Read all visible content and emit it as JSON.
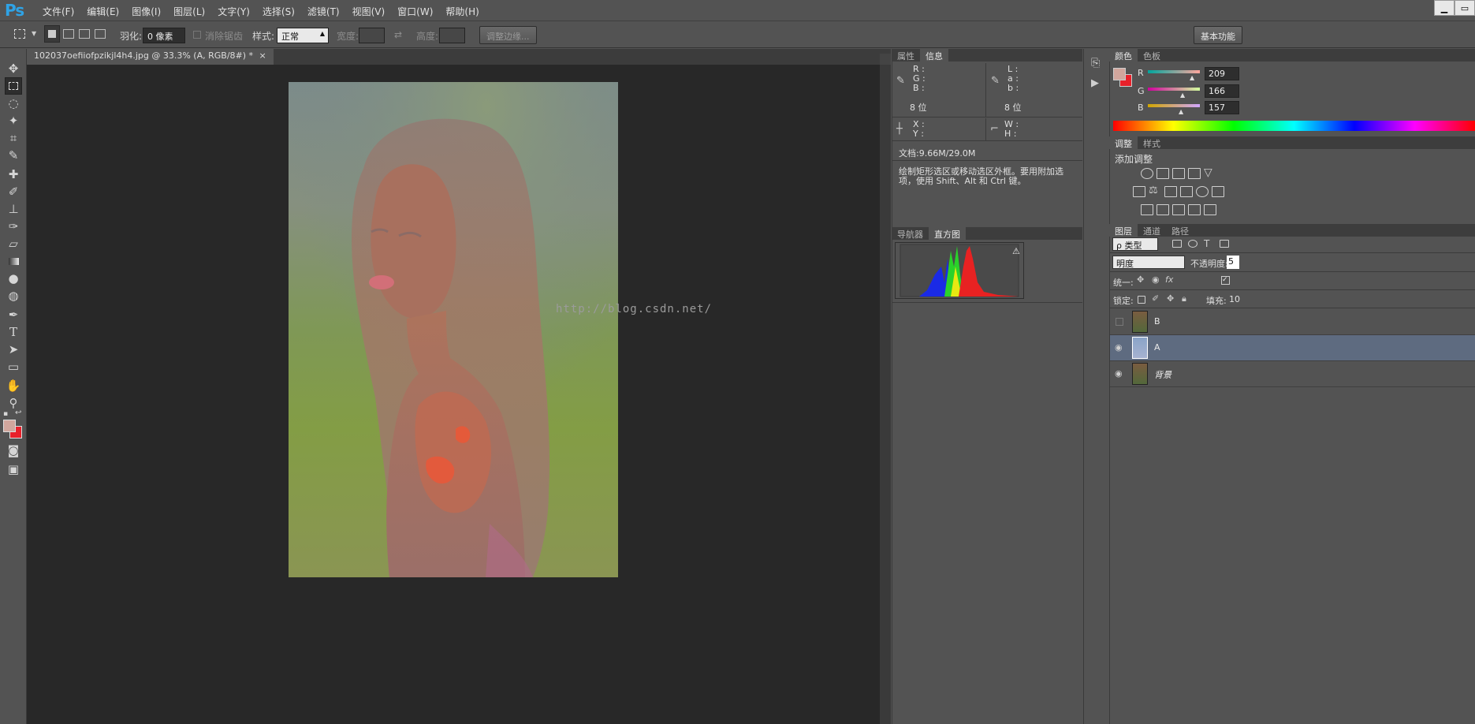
{
  "app": {
    "logo": "Ps"
  },
  "menu": [
    "文件(F)",
    "编辑(E)",
    "图像(I)",
    "图层(L)",
    "文字(Y)",
    "选择(S)",
    "滤镜(T)",
    "视图(V)",
    "窗口(W)",
    "帮助(H)"
  ],
  "window_controls": {
    "minimize": "▁",
    "restore": "▭"
  },
  "options": {
    "feather_label": "羽化:",
    "feather_value": "0 像素",
    "antialias_label": "消除锯齿",
    "style_label": "样式:",
    "style_value": "正常",
    "width_label": "宽度:",
    "height_label": "高度:",
    "refine_edge": "调整边缘...",
    "workspace": "基本功能"
  },
  "document": {
    "tab_title": "102037oefiiofpzikjl4h4.jpg @ 33.3% (A, RGB/8#) *",
    "close": "×",
    "watermark": "http://blog.csdn.net/"
  },
  "info_panel": {
    "tabs": [
      "属性",
      "信息"
    ],
    "active_tab": "信息",
    "rgb": "R :\nG :\nB :",
    "lab": "L :\na :\nb :",
    "bits_left": "8 位",
    "bits_right": "8 位",
    "xy": "X :\nY :",
    "wh": "W :\nH :",
    "doc": "文档:9.66M/29.0M",
    "hint": "绘制矩形选区或移动选区外框。要用附加选\n项，使用 Shift、Alt 和 Ctrl 键。"
  },
  "histogram_panel": {
    "tabs": [
      "导航器",
      "直方图"
    ],
    "active_tab": "直方图",
    "warning": "⚠"
  },
  "color_panel": {
    "tabs": [
      "颜色",
      "色板"
    ],
    "active_tab": "颜色",
    "channels": [
      {
        "label": "R",
        "value": "209"
      },
      {
        "label": "G",
        "value": "166"
      },
      {
        "label": "B",
        "value": "157"
      }
    ],
    "foreground": "#d1a69d",
    "background": "#e8202a"
  },
  "adjust_panel": {
    "tabs": [
      "调整",
      "样式"
    ],
    "active_tab": "调整",
    "title": "添加调整"
  },
  "layers_panel": {
    "tabs": [
      "图层",
      "通道",
      "路径"
    ],
    "active_tab": "图层",
    "filter_kind": "ρ 类型",
    "blend_mode": "明度",
    "opacity_label": "不透明度:",
    "opacity_value": "5",
    "unify_label": "统一:",
    "lock_label": "锁定:",
    "fill_label": "填充:",
    "fill_value": "10",
    "layers": [
      {
        "name": "B",
        "visible": false,
        "selected": false
      },
      {
        "name": "A",
        "visible": true,
        "selected": true
      },
      {
        "name": "背景",
        "visible": true,
        "selected": false
      }
    ]
  }
}
